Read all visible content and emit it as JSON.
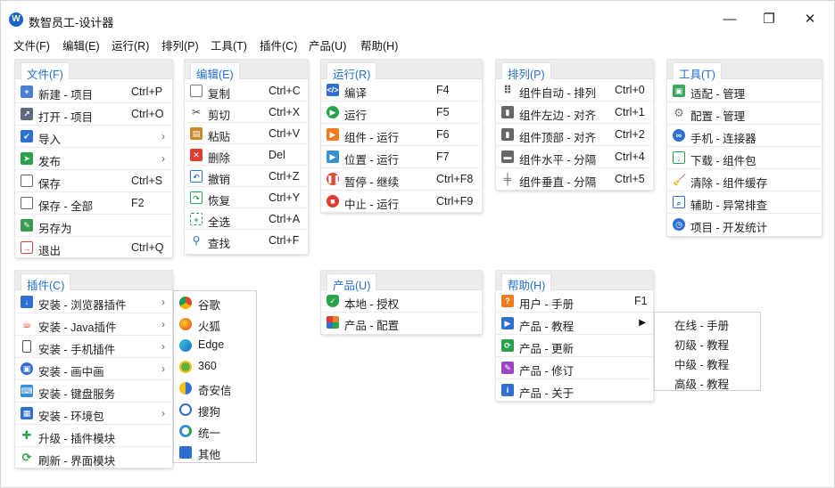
{
  "window": {
    "title": "数智员工-设计器"
  },
  "menubar": [
    "文件(F)",
    "编辑(E)",
    "运行(R)",
    "排列(P)",
    "工具(T)",
    "插件(C)",
    "产品(U)",
    "帮助(H)"
  ],
  "colors": {
    "accent": "#1f6fd1",
    "header_bg": "#ececec"
  },
  "panels": {
    "file": {
      "title": "文件(F)",
      "items": [
        {
          "label": "新建 - 项目",
          "shortcut": "Ctrl+P",
          "icon": "new-project-icon"
        },
        {
          "label": "打开 - 项目",
          "shortcut": "Ctrl+O",
          "icon": "open-project-icon"
        },
        {
          "label": "导入",
          "shortcut": "",
          "icon": "import-icon"
        },
        {
          "label": "发布",
          "shortcut": "",
          "icon": "publish-icon"
        },
        {
          "label": "保存",
          "shortcut": "Ctrl+S",
          "icon": "save-icon"
        },
        {
          "label": "保存 - 全部",
          "shortcut": "F2",
          "icon": "save-all-icon"
        },
        {
          "label": "另存为",
          "shortcut": "",
          "icon": "save-as-icon"
        },
        {
          "label": "退出",
          "shortcut": "Ctrl+Q",
          "icon": "exit-icon"
        }
      ]
    },
    "edit": {
      "title": "编辑(E)",
      "items": [
        {
          "label": "复制",
          "shortcut": "Ctrl+C",
          "icon": "copy-icon"
        },
        {
          "label": "剪切",
          "shortcut": "Ctrl+X",
          "icon": "cut-icon"
        },
        {
          "label": "粘贴",
          "shortcut": "Ctrl+V",
          "icon": "paste-icon"
        },
        {
          "label": "删除",
          "shortcut": "Del",
          "icon": "delete-icon"
        },
        {
          "label": "撤销",
          "shortcut": "Ctrl+Z",
          "icon": "undo-icon"
        },
        {
          "label": "恢复",
          "shortcut": "Ctrl+Y",
          "icon": "redo-icon"
        },
        {
          "label": "全选",
          "shortcut": "Ctrl+A",
          "icon": "select-all-icon"
        },
        {
          "label": "查找",
          "shortcut": "Ctrl+F",
          "icon": "search-icon"
        }
      ]
    },
    "run": {
      "title": "运行(R)",
      "items": [
        {
          "label": "编译",
          "shortcut": "F4",
          "icon": "compile-icon"
        },
        {
          "label": "运行",
          "shortcut": "F5",
          "icon": "run-icon"
        },
        {
          "label": "组件 - 运行",
          "shortcut": "F6",
          "icon": "run-component-icon"
        },
        {
          "label": "位置 - 运行",
          "shortcut": "F7",
          "icon": "run-position-icon"
        },
        {
          "label": "暂停 - 继续",
          "shortcut": "Ctrl+F8",
          "icon": "pause-icon"
        },
        {
          "label": "中止 - 运行",
          "shortcut": "Ctrl+F9",
          "icon": "stop-icon"
        }
      ]
    },
    "arrange": {
      "title": "排列(P)",
      "items": [
        {
          "label": "组件自动 - 排列",
          "shortcut": "Ctrl+0",
          "icon": "auto-arrange-icon"
        },
        {
          "label": "组件左边 - 对齐",
          "shortcut": "Ctrl+1",
          "icon": "align-left-icon"
        },
        {
          "label": "组件顶部 - 对齐",
          "shortcut": "Ctrl+2",
          "icon": "align-top-icon"
        },
        {
          "label": "组件水平 - 分隔",
          "shortcut": "Ctrl+4",
          "icon": "distribute-horizontal-icon"
        },
        {
          "label": "组件垂直 - 分隔",
          "shortcut": "Ctrl+5",
          "icon": "distribute-vertical-icon"
        }
      ]
    },
    "tools": {
      "title": "工具(T)",
      "items": [
        {
          "label": "适配 - 管理",
          "icon": "adapter-icon"
        },
        {
          "label": "配置 - 管理",
          "icon": "gear-icon"
        },
        {
          "label": "手机 - 连接器",
          "icon": "link-icon"
        },
        {
          "label": "下载 - 组件包",
          "icon": "download-icon"
        },
        {
          "label": "清除 - 组件缓存",
          "icon": "broom-icon"
        },
        {
          "label": "辅助 - 异常排查",
          "icon": "inspect-icon"
        },
        {
          "label": "项目 - 开发统计",
          "icon": "stats-icon"
        }
      ]
    },
    "plugins": {
      "title": "插件(C)",
      "items": [
        {
          "label": "安装 - 浏览器插件",
          "arrow": true,
          "icon": "browser-plugin-icon"
        },
        {
          "label": "安装 - Java插件",
          "arrow": true,
          "icon": "java-icon"
        },
        {
          "label": "安装 - 手机插件",
          "arrow": true,
          "icon": "phone-icon"
        },
        {
          "label": "安装 - 画中画",
          "arrow": true,
          "icon": "pip-icon"
        },
        {
          "label": "安装 - 键盘服务",
          "arrow": false,
          "icon": "keyboard-icon"
        },
        {
          "label": "安装 - 环境包",
          "arrow": true,
          "icon": "package-icon"
        },
        {
          "label": "升级 - 插件模块",
          "arrow": false,
          "icon": "puzzle-icon"
        },
        {
          "label": "刷新 - 界面模块",
          "arrow": false,
          "icon": "refresh-icon"
        }
      ]
    },
    "browsers": {
      "items": [
        {
          "label": "谷歌",
          "icon": "chrome-icon"
        },
        {
          "label": "火狐",
          "icon": "firefox-icon"
        },
        {
          "label": "Edge",
          "icon": "edge-icon"
        },
        {
          "label": "360",
          "icon": "browser-360-icon"
        },
        {
          "label": "奇安信",
          "icon": "qianxin-icon"
        },
        {
          "label": "搜狗",
          "icon": "sogou-icon"
        },
        {
          "label": "统一",
          "icon": "uos-icon"
        },
        {
          "label": "其他",
          "icon": "other-icon"
        }
      ]
    },
    "product": {
      "title": "产品(U)",
      "items": [
        {
          "label": "本地 - 授权",
          "icon": "shield-check-icon"
        },
        {
          "label": "产品 - 配置",
          "icon": "config-icon"
        }
      ]
    },
    "help": {
      "title": "帮助(H)",
      "items": [
        {
          "label": "用户 - 手册",
          "shortcut": "F1",
          "arrow": false,
          "icon": "question-icon"
        },
        {
          "label": "产品 - 教程",
          "shortcut": "",
          "arrow": true,
          "icon": "tutorial-icon"
        },
        {
          "label": "产品 - 更新",
          "shortcut": "",
          "arrow": false,
          "icon": "update-icon"
        },
        {
          "label": "产品 - 修订",
          "shortcut": "",
          "arrow": false,
          "icon": "wrench-icon"
        },
        {
          "label": "产品 - 关于",
          "shortcut": "",
          "arrow": false,
          "icon": "info-icon"
        }
      ]
    },
    "tutorials": {
      "items": [
        "在线 - 手册",
        "初级 - 教程",
        "中级 - 教程",
        "高级 - 教程"
      ]
    }
  }
}
